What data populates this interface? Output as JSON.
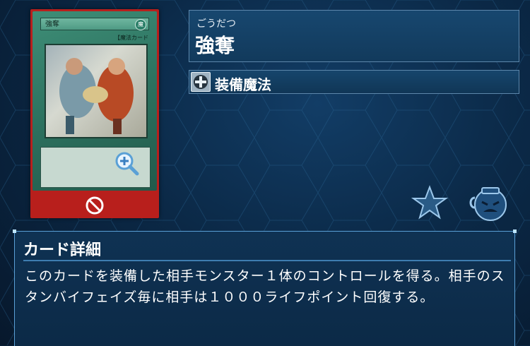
{
  "card": {
    "title_on_card": "強奪",
    "type_line": "【魔法カード",
    "attribute_glyph": "魔",
    "zoom_icon": "magnifier-plus-icon",
    "ban_icon": "prohibited-icon",
    "frame_color": "#b81f1c"
  },
  "info": {
    "ruby": "ごうだつ",
    "name": "強奪",
    "type_icon": "equip-spell-icon",
    "type_label": "装備魔法"
  },
  "actions": {
    "favorite_icon": "star-icon",
    "deck_icon": "pot-of-greed-icon"
  },
  "details": {
    "title": "カード詳細",
    "text": "このカードを装備した相手モンスター１体のコントロールを得る。相手のスタンバイフェイズ毎に相手は１０００ライフポイント回復する。"
  },
  "colors": {
    "accent": "#5aa0d6",
    "panel": "#103656"
  }
}
